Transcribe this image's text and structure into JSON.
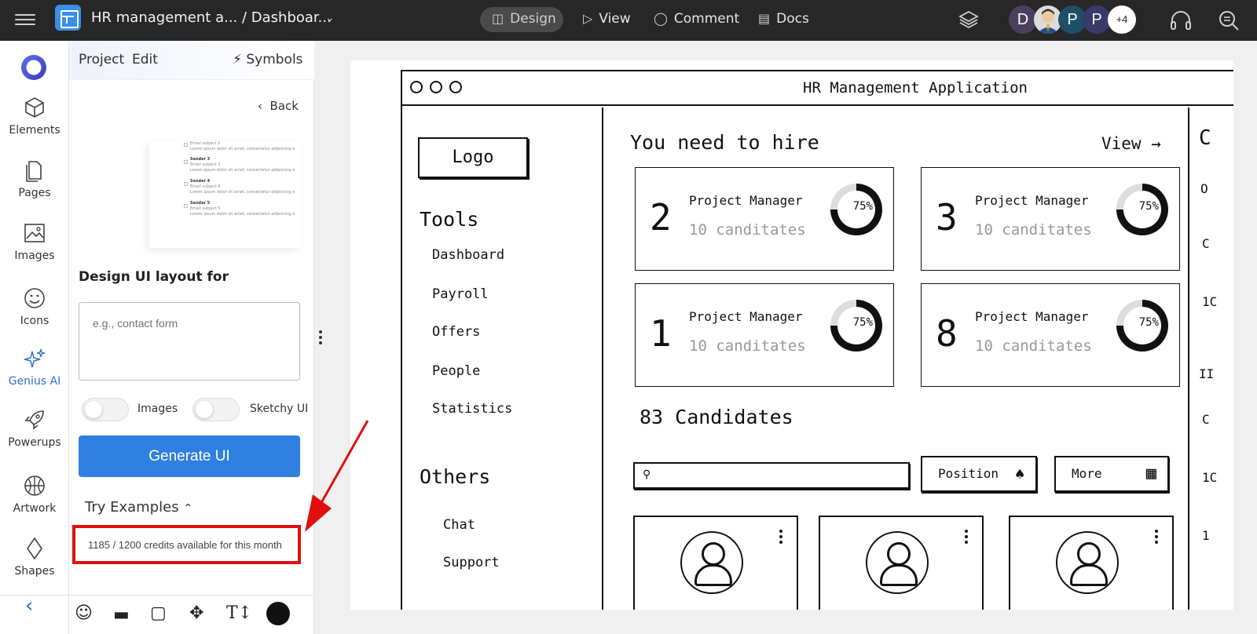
{
  "topbar": {
    "project_title": "HR management a... / Dashboar...",
    "tabs": [
      {
        "label": "Design",
        "icon": "layout-icon"
      },
      {
        "label": "View",
        "icon": "play-icon"
      },
      {
        "label": "Comment",
        "icon": "comment-icon"
      },
      {
        "label": "Docs",
        "icon": "document-icon"
      }
    ],
    "avatars": [
      {
        "initial": "D",
        "color": "#4a3f5c"
      },
      {
        "initial": "",
        "color": "#d8d8d8"
      },
      {
        "initial": "P",
        "color": "#1f4f66"
      },
      {
        "initial": "P",
        "color": "#3a3a6a"
      }
    ],
    "more_avatars": "+4"
  },
  "rail": {
    "items": [
      {
        "label": "Elements",
        "icon": "cube-icon"
      },
      {
        "label": "Pages",
        "icon": "pages-icon"
      },
      {
        "label": "Images",
        "icon": "image-icon"
      },
      {
        "label": "Icons",
        "icon": "smiley-icon"
      },
      {
        "label": "Genius AI",
        "icon": "sparkle-icon",
        "active": true
      },
      {
        "label": "Powerups",
        "icon": "rocket-icon"
      },
      {
        "label": "Artwork",
        "icon": "basketball-icon"
      },
      {
        "label": "Shapes",
        "icon": "diamond-icon"
      }
    ]
  },
  "panel": {
    "menu_project": "Project",
    "menu_edit": "Edit",
    "symbols": "Symbols",
    "back": "Back",
    "preview_rows": [
      "Email subject 2",
      "Lorem ipsum dolor sit amet, consectetur adipiscing e",
      "Sender 3",
      "Email subject 3",
      "Lorem ipsum dolor sit amet, consectetur adipiscing e",
      "Sender 4",
      "Email subject 4",
      "Lorem ipsum dolor sit amet, consectetur adipiscing e",
      "Sender 5",
      "Email subject 5",
      "Lorem ipsum dolor sit amet, consectetur adipiscing e"
    ],
    "design_title": "Design UI layout for",
    "input_placeholder": "e.g., contact form",
    "toggle_images": "Images",
    "toggle_sketchy": "Sketchy UI",
    "generate": "Generate UI",
    "try_examples": "Try Examples",
    "credits": "1185 / 1200 credits available for this month"
  },
  "canvas": {
    "app_title": "HR Management Application",
    "logo": "Logo",
    "tools_heading": "Tools",
    "tools": [
      "Dashboard",
      "Payroll",
      "Offers",
      "People",
      "Statistics"
    ],
    "others_heading": "Others",
    "others": [
      "Chat",
      "Support"
    ],
    "hire_heading": "You need to hire",
    "view_link": "View →",
    "cards": [
      {
        "count": "2",
        "role": "Project Manager",
        "candidates": "10 canditates",
        "percent": "75%"
      },
      {
        "count": "3",
        "role": "Project Manager",
        "candidates": "10 canditates",
        "percent": "75%"
      },
      {
        "count": "1",
        "role": "Project Manager",
        "candidates": "10 canditates",
        "percent": "75%"
      },
      {
        "count": "8",
        "role": "Project Manager",
        "candidates": "10 canditates",
        "percent": "75%"
      }
    ],
    "candidates_heading": "83 Candidates",
    "position_btn": "Position",
    "more_btn": "More",
    "right_col_letters": [
      "C",
      "O",
      "C",
      "1C",
      "II",
      "C",
      "1C",
      "1"
    ]
  }
}
